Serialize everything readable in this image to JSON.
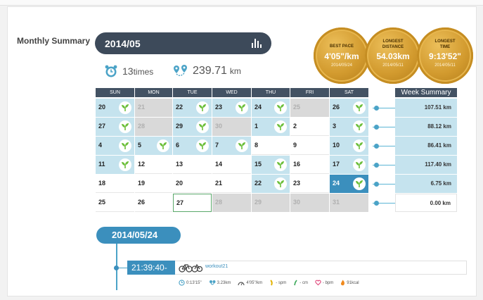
{
  "header": {
    "title": "Monthly Summary",
    "month": "2014/05",
    "workouts": {
      "count": "13",
      "unit": "times"
    },
    "distance": {
      "value": "239.71",
      "unit": "km"
    }
  },
  "medals": [
    {
      "title_lines": [
        "BEST PACE"
      ],
      "value": "4'05\"/km",
      "date": "2014/05/24"
    },
    {
      "title_lines": [
        "LONGEST",
        "DISTANCE"
      ],
      "value": "54.03km",
      "date": "2014/05/11"
    },
    {
      "title_lines": [
        "LONGEST",
        "TIME"
      ],
      "value": "9:13'52\"",
      "date": "2014/05/11"
    }
  ],
  "calendar": {
    "weekdays": [
      "SUN",
      "MON",
      "TUE",
      "WED",
      "THU",
      "FRI",
      "SAT"
    ],
    "weeks": [
      [
        {
          "d": "20",
          "s": "a",
          "w": true
        },
        {
          "d": "21",
          "s": "o"
        },
        {
          "d": "22",
          "s": "a",
          "w": true
        },
        {
          "d": "23",
          "s": "a",
          "w": true
        },
        {
          "d": "24",
          "s": "a",
          "w": true
        },
        {
          "d": "25",
          "s": "o"
        },
        {
          "d": "26",
          "s": "a",
          "w": true
        }
      ],
      [
        {
          "d": "27",
          "s": "a",
          "w": true
        },
        {
          "d": "28",
          "s": "o"
        },
        {
          "d": "29",
          "s": "a",
          "w": true
        },
        {
          "d": "30",
          "s": "o"
        },
        {
          "d": "1",
          "s": "a",
          "w": true
        },
        {
          "d": "2",
          "s": "n"
        },
        {
          "d": "3",
          "s": "a",
          "w": true
        }
      ],
      [
        {
          "d": "4",
          "s": "a",
          "w": true
        },
        {
          "d": "5",
          "s": "a",
          "w": true
        },
        {
          "d": "6",
          "s": "a",
          "w": true
        },
        {
          "d": "7",
          "s": "a",
          "w": true
        },
        {
          "d": "8",
          "s": "n"
        },
        {
          "d": "9",
          "s": "n"
        },
        {
          "d": "10",
          "s": "a",
          "w": true
        }
      ],
      [
        {
          "d": "11",
          "s": "a",
          "w": true
        },
        {
          "d": "12",
          "s": "n"
        },
        {
          "d": "13",
          "s": "n"
        },
        {
          "d": "14",
          "s": "n"
        },
        {
          "d": "15",
          "s": "a",
          "w": true
        },
        {
          "d": "16",
          "s": "n"
        },
        {
          "d": "17",
          "s": "a",
          "w": true
        }
      ],
      [
        {
          "d": "18",
          "s": "n"
        },
        {
          "d": "19",
          "s": "n"
        },
        {
          "d": "20",
          "s": "n"
        },
        {
          "d": "21",
          "s": "n"
        },
        {
          "d": "22",
          "s": "a",
          "w": true
        },
        {
          "d": "23",
          "s": "n"
        },
        {
          "d": "24",
          "s": "sel",
          "w": true
        }
      ],
      [
        {
          "d": "25",
          "s": "n"
        },
        {
          "d": "26",
          "s": "n"
        },
        {
          "d": "27",
          "s": "today"
        },
        {
          "d": "28",
          "s": "o"
        },
        {
          "d": "29",
          "s": "o"
        },
        {
          "d": "30",
          "s": "o"
        },
        {
          "d": "31",
          "s": "o"
        }
      ]
    ]
  },
  "week_summary": {
    "title": "Week Summary",
    "values": [
      "107.51 km",
      "88.12 km",
      "86.41 km",
      "117.40 km",
      "6.75 km",
      "0.00 km"
    ]
  },
  "detail": {
    "date": "2014/05/24",
    "time": "21:39:40-",
    "workout_name": "workout21",
    "stats": [
      {
        "icon": "clock-icon",
        "text": "0:13'15\""
      },
      {
        "icon": "distance-pin-icon",
        "text": "3.23km"
      },
      {
        "icon": "pace-gauge-icon",
        "text": "4'05\"/km"
      },
      {
        "icon": "cadence-icon",
        "text": "- spm"
      },
      {
        "icon": "stride-icon",
        "text": "- cm"
      },
      {
        "icon": "heart-icon",
        "text": "- bpm"
      },
      {
        "icon": "flame-icon",
        "text": "91kcal"
      }
    ]
  },
  "colors": {
    "dark": "#3d4a5a",
    "accent_blue": "#3b8fbd",
    "active_cell": "#c5e3ee",
    "gold": "#d29a2e",
    "leaf_green": "#6cbf3a"
  }
}
